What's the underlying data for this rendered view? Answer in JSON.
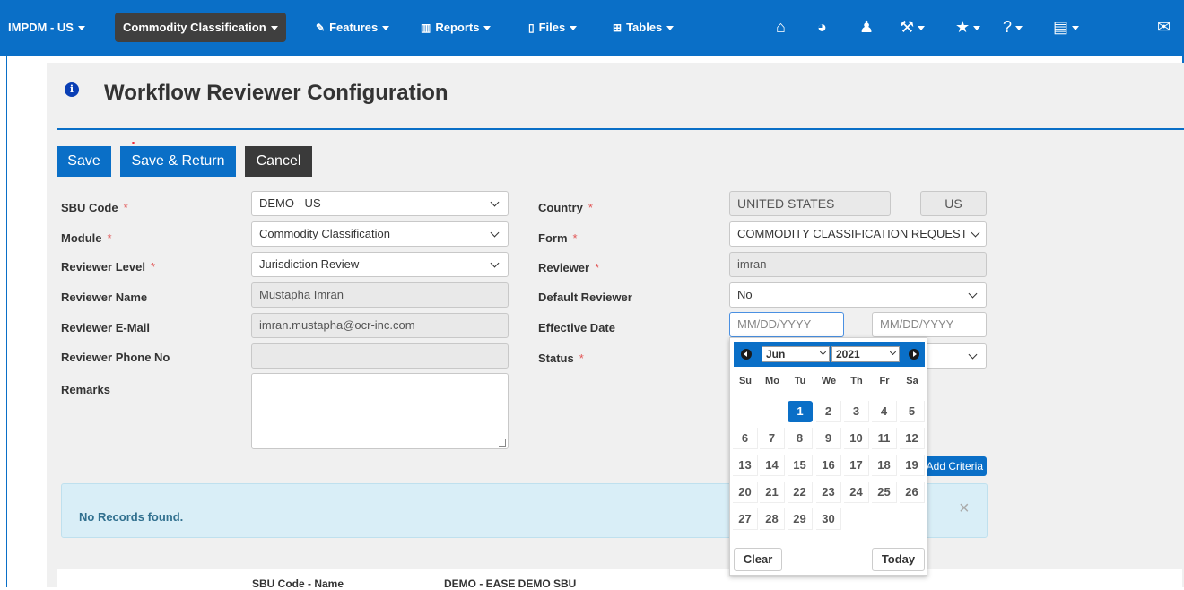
{
  "nav": {
    "app": "IMPDM - US",
    "active": "Commodity Classification",
    "features": "Features",
    "reports": "Reports",
    "files": "Files",
    "tables": "Tables",
    "icons": [
      "home-icon",
      "dashboard-icon",
      "bell-icon",
      "wrench-icon",
      "star-icon",
      "help-icon",
      "book-icon",
      "envelope-icon"
    ]
  },
  "page": {
    "title": "Workflow Reviewer Configuration"
  },
  "buttons": {
    "save": "Save",
    "save_return": "Save & Return",
    "cancel": "Cancel",
    "add_criteria": "Add Criteria"
  },
  "form": {
    "sbu_code_label": "SBU Code",
    "sbu_code": "DEMO - US",
    "module_label": "Module",
    "module": "Commodity Classification",
    "reviewer_level_label": "Reviewer Level",
    "reviewer_level": "Jurisdiction Review",
    "reviewer_name_label": "Reviewer Name",
    "reviewer_name": "Mustapha Imran",
    "reviewer_email_label": "Reviewer E-Mail",
    "reviewer_email": "imran.mustapha@ocr-inc.com",
    "reviewer_phone_label": "Reviewer Phone No",
    "reviewer_phone": "",
    "remarks_label": "Remarks",
    "country_label": "Country",
    "country": "UNITED STATES",
    "country_code": "US",
    "form_label": "Form",
    "form": "COMMODITY CLASSIFICATION REQUEST",
    "reviewer_label": "Reviewer",
    "reviewer": "imran",
    "default_reviewer_label": "Default Reviewer",
    "default_reviewer": "No",
    "effective_date_label": "Effective Date",
    "date_placeholder": "MM/DD/YYYY",
    "status_label": "Status",
    "required_mark": "*"
  },
  "alert": {
    "text": "No Records found.",
    "close": "×"
  },
  "bottom": {
    "sbu_label": "SBU Code - Name",
    "sbu_value": "DEMO - EASE DEMO SBU"
  },
  "datepicker": {
    "month": "Jun",
    "year": "2021",
    "dow": [
      "Su",
      "Mo",
      "Tu",
      "We",
      "Th",
      "Fr",
      "Sa"
    ],
    "days": [
      "1",
      "2",
      "3",
      "4",
      "5",
      "6",
      "7",
      "8",
      "9",
      "10",
      "11",
      "12",
      "13",
      "14",
      "15",
      "16",
      "17",
      "18",
      "19",
      "20",
      "21",
      "22",
      "23",
      "24",
      "25",
      "26",
      "27",
      "28",
      "29",
      "30"
    ],
    "first_weekday": 2,
    "selected": "1",
    "clear": "Clear",
    "today": "Today"
  }
}
